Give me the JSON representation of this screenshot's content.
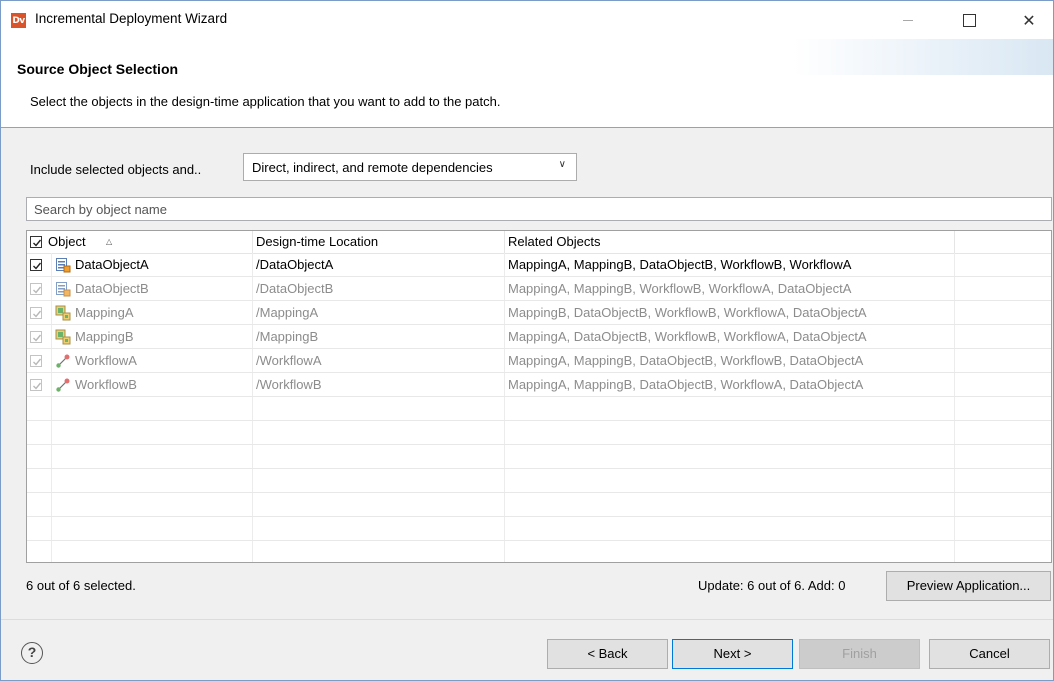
{
  "window": {
    "title": "Incremental Deployment Wizard",
    "app_icon_text": "Dv",
    "controls": {
      "minimize": "minimize-icon",
      "maximize": "maximize-icon",
      "close": "close-icon"
    }
  },
  "header": {
    "title": "Source Object Selection",
    "description": "Select the objects in the design-time application that you want to add to the patch."
  },
  "include": {
    "label": "Include selected objects and..",
    "selected_value": "Direct, indirect, and remote dependencies"
  },
  "search": {
    "placeholder": "Search by object name",
    "value": ""
  },
  "table": {
    "columns": [
      "Object",
      "Design-time Location",
      "Related Objects"
    ],
    "sort_indicator": "^",
    "header_checkbox_checked": true,
    "rows": [
      {
        "name": "DataObjectA",
        "location": "/DataObjectA",
        "related": "MappingA, MappingB, DataObjectB, WorkflowB, WorkflowA",
        "icon": "data-object-icon",
        "checked": true,
        "enabled": true
      },
      {
        "name": "DataObjectB",
        "location": "/DataObjectB",
        "related": "MappingA, MappingB, WorkflowB, WorkflowA, DataObjectA",
        "icon": "data-object-icon",
        "checked": true,
        "enabled": false
      },
      {
        "name": "MappingA",
        "location": "/MappingA",
        "related": "MappingB, DataObjectB, WorkflowB, WorkflowA, DataObjectA",
        "icon": "mapping-icon",
        "checked": true,
        "enabled": false
      },
      {
        "name": "MappingB",
        "location": "/MappingB",
        "related": "MappingA, DataObjectB, WorkflowB, WorkflowA, DataObjectA",
        "icon": "mapping-icon",
        "checked": true,
        "enabled": false
      },
      {
        "name": "WorkflowA",
        "location": "/WorkflowA",
        "related": "MappingA, MappingB, DataObjectB, WorkflowB, DataObjectA",
        "icon": "workflow-icon",
        "checked": true,
        "enabled": false
      },
      {
        "name": "WorkflowB",
        "location": "/WorkflowB",
        "related": "MappingA, MappingB, DataObjectB, WorkflowA, DataObjectA",
        "icon": "workflow-icon",
        "checked": true,
        "enabled": false
      }
    ]
  },
  "status": {
    "selected_count": "6 out of 6 selected.",
    "update_summary": "Update: 6 out of 6. Add: 0",
    "preview_button": "Preview Application..."
  },
  "buttons": {
    "help": "?",
    "back": "< Back",
    "next": "Next >",
    "finish": "Finish",
    "cancel": "Cancel"
  },
  "colors": {
    "app_icon": "#d9542b",
    "default_button_border": "#0078d7",
    "disabled_text": "#8c8c8c"
  }
}
